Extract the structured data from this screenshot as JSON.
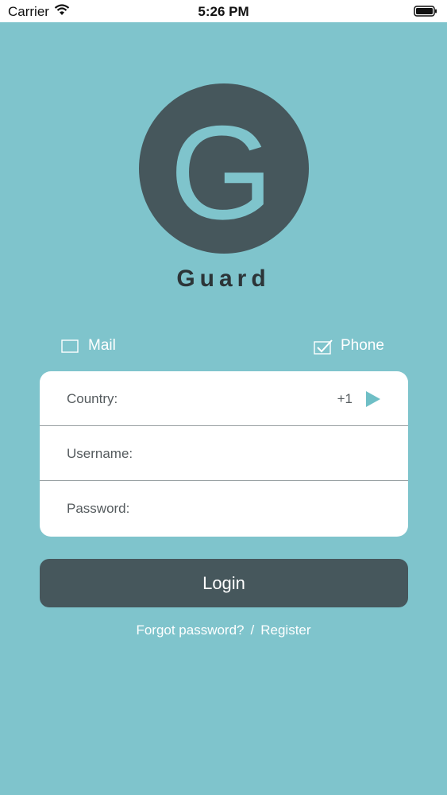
{
  "status_bar": {
    "carrier": "Carrier",
    "time": "5:26 PM"
  },
  "logo": {
    "letter": "G",
    "background_color": "#46575c",
    "letter_color": "#7fc4cc"
  },
  "app_name": "Guard",
  "login_type": {
    "mail_label": "Mail",
    "mail_checked": false,
    "phone_label": "Phone",
    "phone_checked": true
  },
  "form": {
    "country_label": "Country:",
    "country_code": "+1",
    "username_label": "Username:",
    "username_value": "",
    "password_label": "Password:",
    "password_value": ""
  },
  "login_button_label": "Login",
  "links": {
    "forgot_password": "Forgot password?",
    "separator": "/",
    "register": "Register"
  },
  "colors": {
    "background": "#7fc4cc",
    "primary_dark": "#46575c",
    "card": "#ffffff",
    "accent_arrow": "#6fbfc6"
  }
}
